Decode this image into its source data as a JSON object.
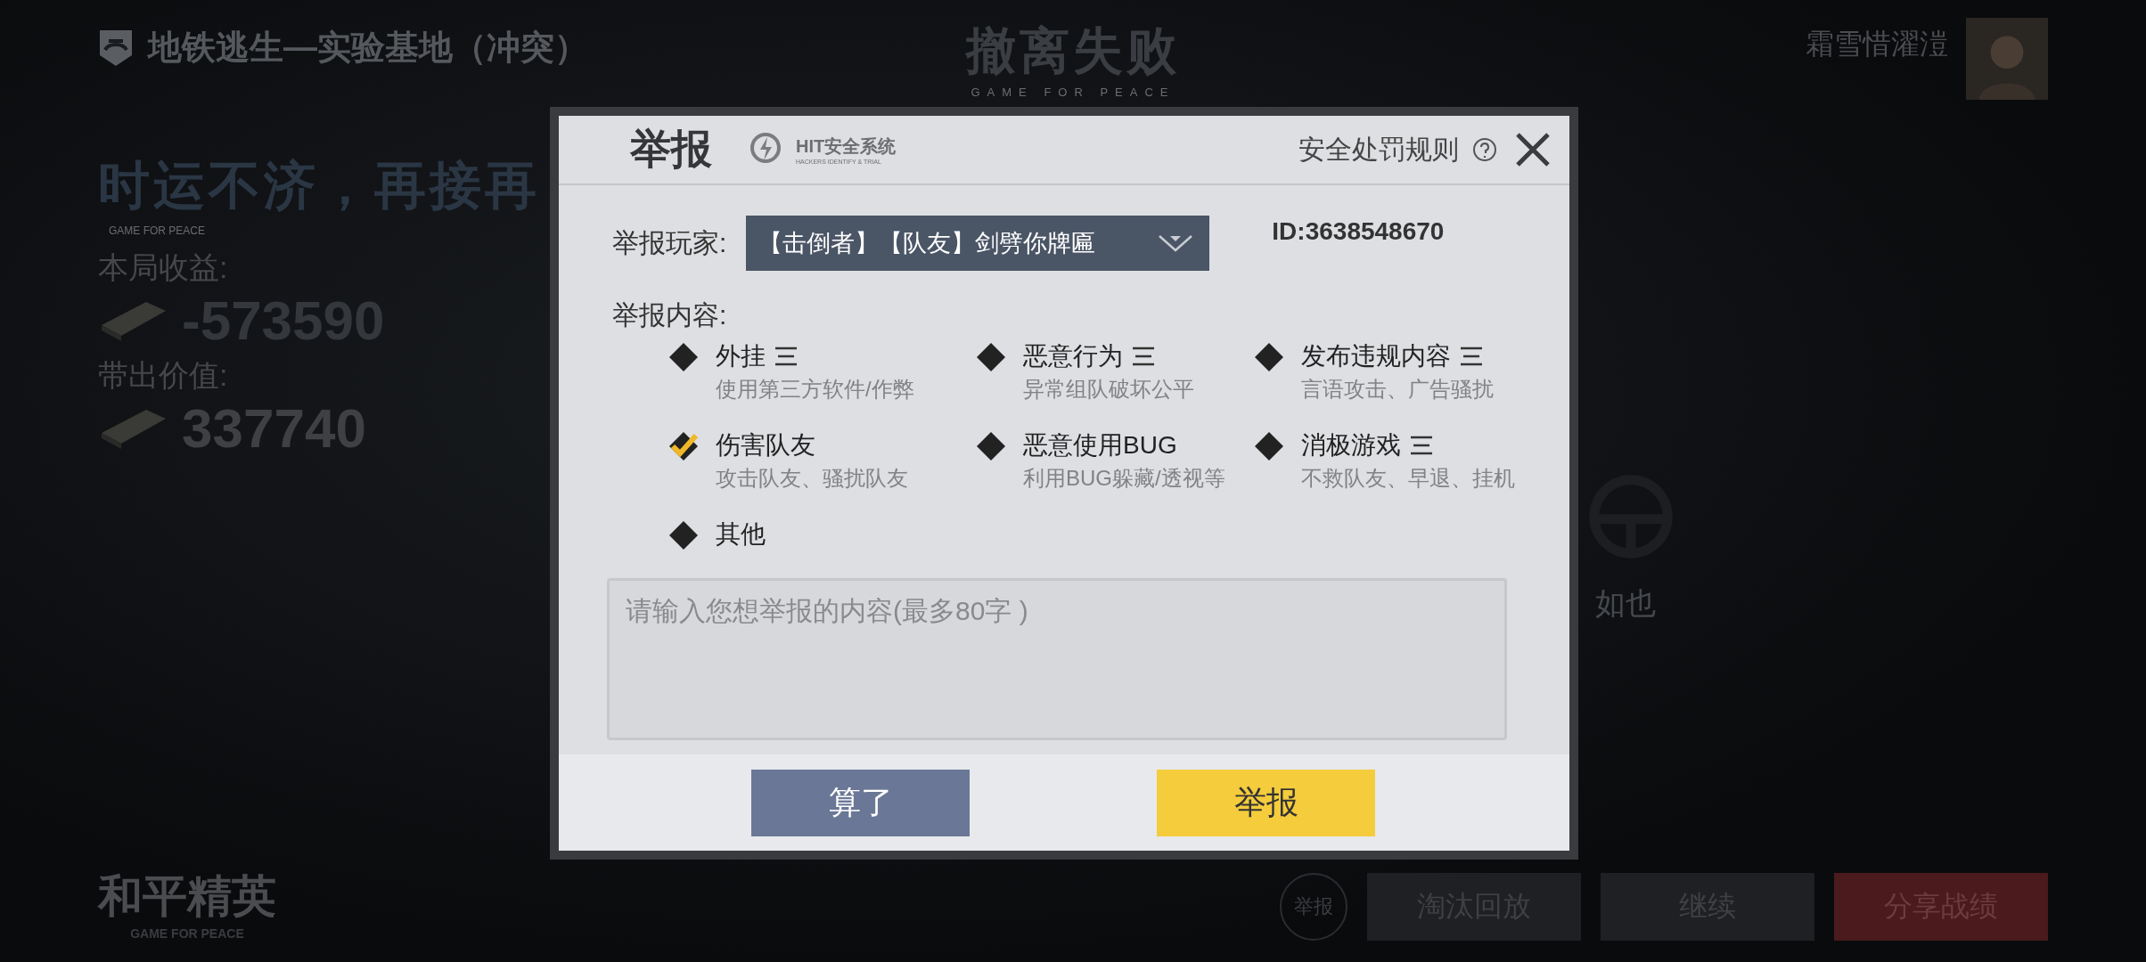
{
  "top_bar": {
    "map_title": "地铁逃生—实验基地（冲突）",
    "result_title": "撤离失败",
    "result_subtitle": "GAME FOR PEACE",
    "player_name": "霜雪惜濯溰"
  },
  "summary": {
    "headline": "时运不济，再接再",
    "tagline": "GAME FOR PEACE",
    "income_label": "本局收益:",
    "income_value": "-573590",
    "carry_label": "带出价值:",
    "carry_value": "337740",
    "hidden_label": "如也"
  },
  "brand": {
    "name": "和平精英",
    "subtitle": "GAME FOR PEACE"
  },
  "actions": [
    {
      "label": "举报",
      "kind": "round"
    },
    {
      "label": "淘汰回放",
      "kind": "plain"
    },
    {
      "label": "继续",
      "kind": "plain"
    },
    {
      "label": "分享战绩",
      "kind": "primary"
    }
  ],
  "dialog": {
    "title": "举报",
    "system_name": "HIT安全系统",
    "system_tagline": "HACKERS IDENTIFY & TRIAL",
    "rules_link": "安全处罚规则",
    "player_label": "举报玩家:",
    "player_choice": "【击倒者】【队友】剑劈你牌匾",
    "player_id": "ID:3638548670",
    "content_label": "举报内容:",
    "options": [
      {
        "title": "外挂",
        "description": "使用第三方软件/作弊",
        "selected": false,
        "has_details": true
      },
      {
        "title": "恶意行为",
        "description": "异常组队破坏公平",
        "selected": false,
        "has_details": true
      },
      {
        "title": "发布违规内容",
        "description": "言语攻击、广告骚扰",
        "selected": false,
        "has_details": true
      },
      {
        "title": "伤害队友",
        "description": "攻击队友、骚扰队友",
        "selected": true,
        "has_details": false
      },
      {
        "title": "恶意使用BUG",
        "description": "利用BUG躲藏/透视等",
        "selected": false,
        "has_details": false
      },
      {
        "title": "消极游戏",
        "description": "不救队友、早退、挂机",
        "selected": false,
        "has_details": true
      },
      {
        "title": "其他",
        "selected": false,
        "has_details": false
      }
    ],
    "comment": {
      "placeholder": "请输入您想举报的内容(最多80字 )"
    },
    "buttons": [
      {
        "label": "算了",
        "kind": "cancel"
      },
      {
        "label": "举报",
        "kind": "confirm"
      }
    ]
  }
}
